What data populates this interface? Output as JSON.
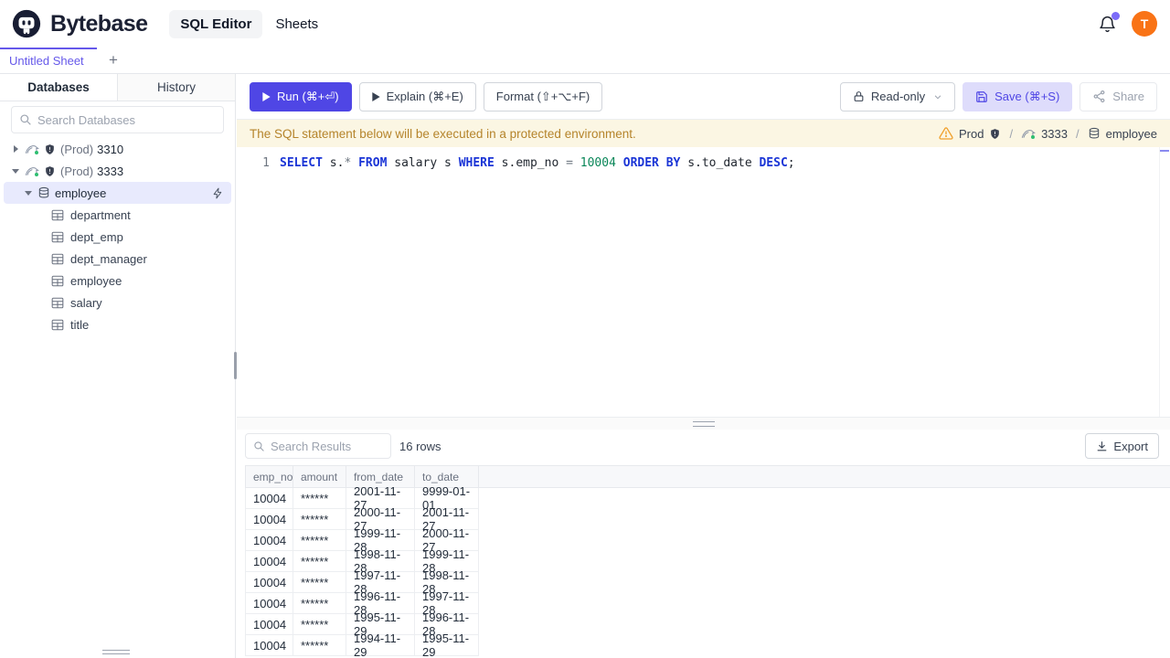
{
  "colors": {
    "accent": "#4f46e5",
    "brand_text": "#1b2033",
    "active_tab": "#6558ea",
    "avatar_bg": "#f97316",
    "notification_dot": "#7c6cf8",
    "banner_bg": "#fbf6e3",
    "banner_text": "#b5842b",
    "selected_tree_row_bg": "#e8eafd",
    "sql_keyword": "#1b35d6",
    "sql_number": "#098658",
    "mysql_status_green": "#2fbf71"
  },
  "header": {
    "brand": "Bytebase",
    "nav_sql_editor": "SQL Editor",
    "nav_sheets": "Sheets",
    "avatar_initial": "T"
  },
  "sheet_tabs": {
    "active_tab": "Untitled Sheet",
    "add_button": "+"
  },
  "sidebar": {
    "tab_databases": "Databases",
    "tab_history": "History",
    "search_placeholder": "Search Databases",
    "instances": [
      {
        "env": "(Prod)",
        "name": "3310",
        "expanded": false
      },
      {
        "env": "(Prod)",
        "name": "3333",
        "expanded": true
      }
    ],
    "database": "employee",
    "tables": [
      "department",
      "dept_emp",
      "dept_manager",
      "employee",
      "salary",
      "title"
    ]
  },
  "toolbar": {
    "run": "Run (⌘+⏎)",
    "explain": "Explain (⌘+E)",
    "format": "Format (⇧+⌥+F)",
    "readonly": "Read-only",
    "save": "Save (⌘+S)",
    "share": "Share"
  },
  "banner": {
    "message": "The SQL statement below will be executed in a protected environment.",
    "environment": "Prod",
    "separator": "/",
    "instance": "3333",
    "database": "employee"
  },
  "editor": {
    "line_number": "1",
    "tokens": [
      {
        "t": "SELECT",
        "c": "keyword"
      },
      {
        "t": " s.",
        "c": "plain"
      },
      {
        "t": "*",
        "c": "operator"
      },
      {
        "t": " ",
        "c": "plain"
      },
      {
        "t": "FROM",
        "c": "keyword"
      },
      {
        "t": " salary s ",
        "c": "plain"
      },
      {
        "t": "WHERE",
        "c": "keyword"
      },
      {
        "t": " s.emp_no ",
        "c": "plain"
      },
      {
        "t": "=",
        "c": "operator"
      },
      {
        "t": " ",
        "c": "plain"
      },
      {
        "t": "10004",
        "c": "number"
      },
      {
        "t": " ",
        "c": "plain"
      },
      {
        "t": "ORDER",
        "c": "keyword"
      },
      {
        "t": " ",
        "c": "plain"
      },
      {
        "t": "BY",
        "c": "keyword"
      },
      {
        "t": " s.to_date ",
        "c": "plain"
      },
      {
        "t": "DESC",
        "c": "keyword"
      },
      {
        "t": ";",
        "c": "plain"
      }
    ]
  },
  "results": {
    "search_placeholder": "Search Results",
    "row_count": "16 rows",
    "export": "Export",
    "columns": [
      "emp_no",
      "amount",
      "from_date",
      "to_date"
    ],
    "rows": [
      [
        "10004",
        "******",
        "2001-11-27",
        "9999-01-01"
      ],
      [
        "10004",
        "******",
        "2000-11-27",
        "2001-11-27"
      ],
      [
        "10004",
        "******",
        "1999-11-28",
        "2000-11-27"
      ],
      [
        "10004",
        "******",
        "1998-11-28",
        "1999-11-28"
      ],
      [
        "10004",
        "******",
        "1997-11-28",
        "1998-11-28"
      ],
      [
        "10004",
        "******",
        "1996-11-28",
        "1997-11-28"
      ],
      [
        "10004",
        "******",
        "1995-11-29",
        "1996-11-28"
      ],
      [
        "10004",
        "******",
        "1994-11-29",
        "1995-11-29"
      ]
    ]
  }
}
